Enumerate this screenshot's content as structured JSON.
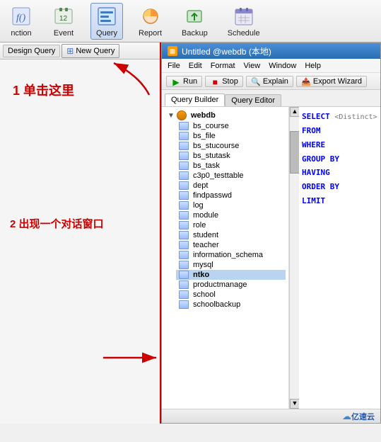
{
  "toolbar": {
    "items": [
      {
        "id": "function",
        "label": "nction"
      },
      {
        "id": "event",
        "label": "Event"
      },
      {
        "id": "query",
        "label": "Query"
      },
      {
        "id": "report",
        "label": "Report"
      },
      {
        "id": "backup",
        "label": "Backup"
      },
      {
        "id": "schedule",
        "label": "Schedule"
      }
    ]
  },
  "subtoolbar": {
    "design_query": "Design Query",
    "new_query": "New Query"
  },
  "annotations": {
    "step1": "1 单击这里",
    "step2": "2 出现一个对话窗口"
  },
  "right_window": {
    "title": "Untitled @webdb (本地)",
    "menu": [
      "File",
      "Edit",
      "Format",
      "View",
      "Window",
      "Help"
    ],
    "actions": [
      "Run",
      "Stop",
      "Explain",
      "Export Wizard"
    ],
    "query_tabs": [
      "Query Builder",
      "Query Editor"
    ]
  },
  "tree": {
    "root": "webdb",
    "items": [
      "bs_course",
      "bs_file",
      "bs_stucourse",
      "bs_stutask",
      "bs_task",
      "c3p0_testtable",
      "dept",
      "findpasswd",
      "log",
      "module",
      "role",
      "student",
      "teacher",
      "information_schema",
      "mysql",
      "ntko",
      "productmanage",
      "school",
      "schoolbackup"
    ]
  },
  "sql_panel": {
    "select": "SELECT",
    "distinct_hint": "<Distinct>",
    "from": "FROM",
    "where": "WHERE",
    "group_by": "GROUP BY",
    "having": "HAVING",
    "order_by": "ORDER BY",
    "limit": "LIMIT"
  },
  "bottom_bar": {
    "logo": "亿速云"
  }
}
